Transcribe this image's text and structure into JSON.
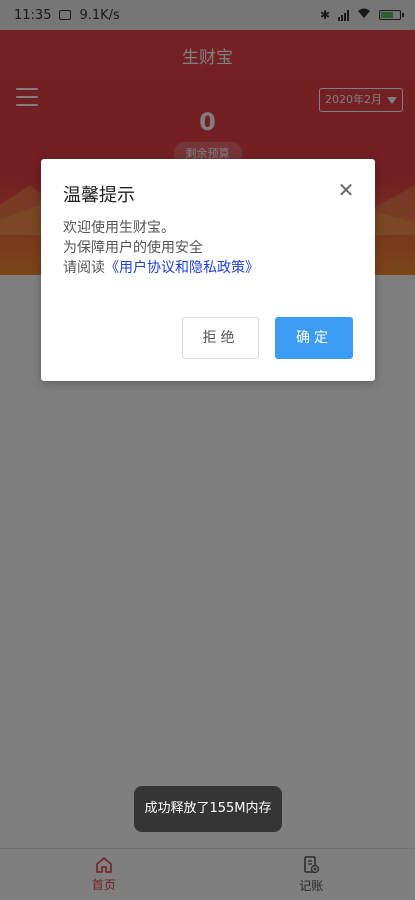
{
  "status_bar": {
    "time": "11:35",
    "speed": "9.1K/s"
  },
  "header": {
    "title": "生财宝",
    "month_selector": "2020年2月",
    "balance": "0",
    "balance_label": "剩余预算"
  },
  "dialog": {
    "title": "温馨提示",
    "line1": "欢迎使用生财宝。",
    "line2": "为保障用户的使用安全",
    "line3_prefix": "请阅读",
    "agreement_link": "《用户协议和隐私政策》",
    "reject_label": "拒绝",
    "confirm_label": "确定"
  },
  "toast": {
    "message": "成功释放了155M内存"
  },
  "tabbar": {
    "tabs": [
      {
        "label": "首页",
        "icon": "home-icon",
        "active": true
      },
      {
        "label": "记账",
        "icon": "ledger-icon",
        "active": false
      }
    ]
  },
  "colors": {
    "header_red": "#e63e46",
    "header_orange": "#f58b32",
    "confirm_blue": "#3c9cf3",
    "link_blue": "#1e3fd8",
    "active_tab": "#e63e46"
  }
}
